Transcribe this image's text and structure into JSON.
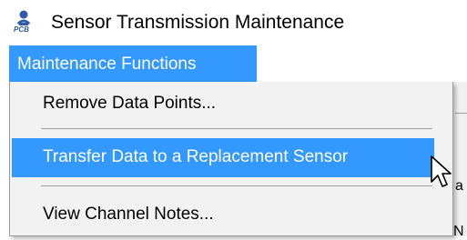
{
  "window": {
    "title": "Sensor Transmission Maintenance",
    "icon": "sensor-app-icon"
  },
  "menubar": {
    "items": [
      {
        "label": "Maintenance Functions",
        "active": true
      }
    ]
  },
  "popup_menu": {
    "items": [
      {
        "label": "Remove Data Points...",
        "highlighted": false
      },
      {
        "label": "Transfer Data to a Replacement Sensor",
        "highlighted": true
      },
      {
        "label": "View Channel Notes...",
        "highlighted": false
      }
    ]
  },
  "background_fragments": {
    "frag1": "a",
    "frag2": "N"
  },
  "colors": {
    "highlight": "#3399ff",
    "menu_background": "#f2f2f2",
    "highlight_text": "#ffffff"
  },
  "cursor": {
    "icon": "arrow-pointer-icon"
  }
}
